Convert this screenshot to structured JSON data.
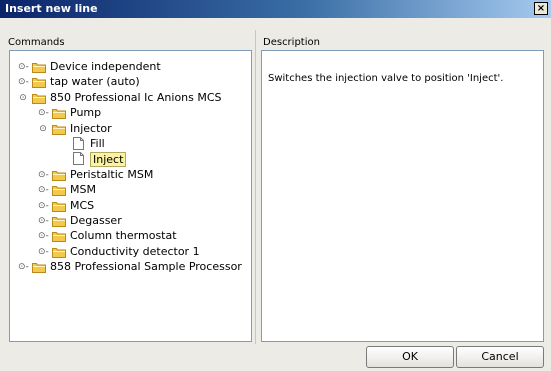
{
  "window": {
    "title": "Insert new line",
    "close_glyph": "×"
  },
  "commands_label": "Commands",
  "description_label": "Description",
  "description_text": "Switches the injection valve to position 'Inject'.",
  "tree": [
    {
      "label": "Device independent",
      "expander": "⊙-",
      "type": "folder",
      "depth": 0,
      "selected": false
    },
    {
      "label": "tap water (auto)",
      "expander": "⊙-",
      "type": "folder",
      "depth": 0,
      "selected": false
    },
    {
      "label": "850 Professional Ic Anions MCS",
      "expander": "⊙",
      "type": "folder",
      "depth": 0,
      "selected": false
    },
    {
      "label": "Pump",
      "expander": "⊙-",
      "type": "folder",
      "depth": 1,
      "selected": false
    },
    {
      "label": "Injector",
      "expander": "⊙",
      "type": "folder",
      "depth": 1,
      "selected": false
    },
    {
      "label": "Fill",
      "expander": "",
      "type": "file",
      "depth": 2,
      "selected": false
    },
    {
      "label": "Inject",
      "expander": "",
      "type": "file",
      "depth": 2,
      "selected": true
    },
    {
      "label": "Peristaltic MSM",
      "expander": "⊙-",
      "type": "folder",
      "depth": 1,
      "selected": false
    },
    {
      "label": "MSM",
      "expander": "⊙-",
      "type": "folder",
      "depth": 1,
      "selected": false
    },
    {
      "label": "MCS",
      "expander": "⊙-",
      "type": "folder",
      "depth": 1,
      "selected": false
    },
    {
      "label": "Degasser",
      "expander": "⊙-",
      "type": "folder",
      "depth": 1,
      "selected": false
    },
    {
      "label": "Column thermostat",
      "expander": "⊙-",
      "type": "folder",
      "depth": 1,
      "selected": false
    },
    {
      "label": "Conductivity detector 1",
      "expander": "⊙-",
      "type": "folder",
      "depth": 1,
      "selected": false
    },
    {
      "label": "858 Professional Sample Processor",
      "expander": "⊙-",
      "type": "folder",
      "depth": 0,
      "selected": false
    }
  ],
  "buttons": {
    "ok": "OK",
    "cancel": "Cancel"
  },
  "colors": {
    "folder": "#f2c94c",
    "selection": "#fbf3a4",
    "title_bar": "#0a246a"
  }
}
